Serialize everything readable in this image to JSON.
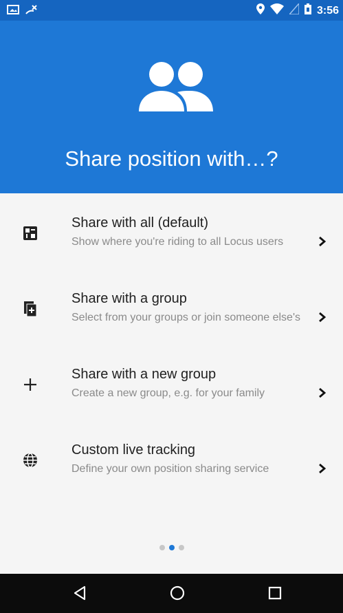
{
  "status_bar": {
    "time": "3:56",
    "left_icons": [
      "image-icon",
      "missed-call-icon"
    ],
    "right_icons": [
      "location-pin-icon",
      "wifi-icon",
      "signal-icon",
      "battery-icon"
    ]
  },
  "header": {
    "icon": "people-icon",
    "title": "Share position with…?",
    "background": "#1e78d6"
  },
  "options": [
    {
      "icon": "share-all-icon",
      "title": "Share with all (default)",
      "description": "Show where you're riding to all Locus users"
    },
    {
      "icon": "group-add-icon",
      "title": "Share with a group",
      "description": "Select from your groups or join someone else's"
    },
    {
      "icon": "plus-icon",
      "title": "Share with a new group",
      "description": "Create a new group, e.g. for your family"
    },
    {
      "icon": "globe-icon",
      "title": "Custom live tracking",
      "description": "Define your own position sharing service"
    }
  ],
  "pager": {
    "count": 3,
    "active_index": 1
  },
  "nav_bar": {
    "buttons": [
      "back-icon",
      "home-icon",
      "recents-icon"
    ]
  }
}
